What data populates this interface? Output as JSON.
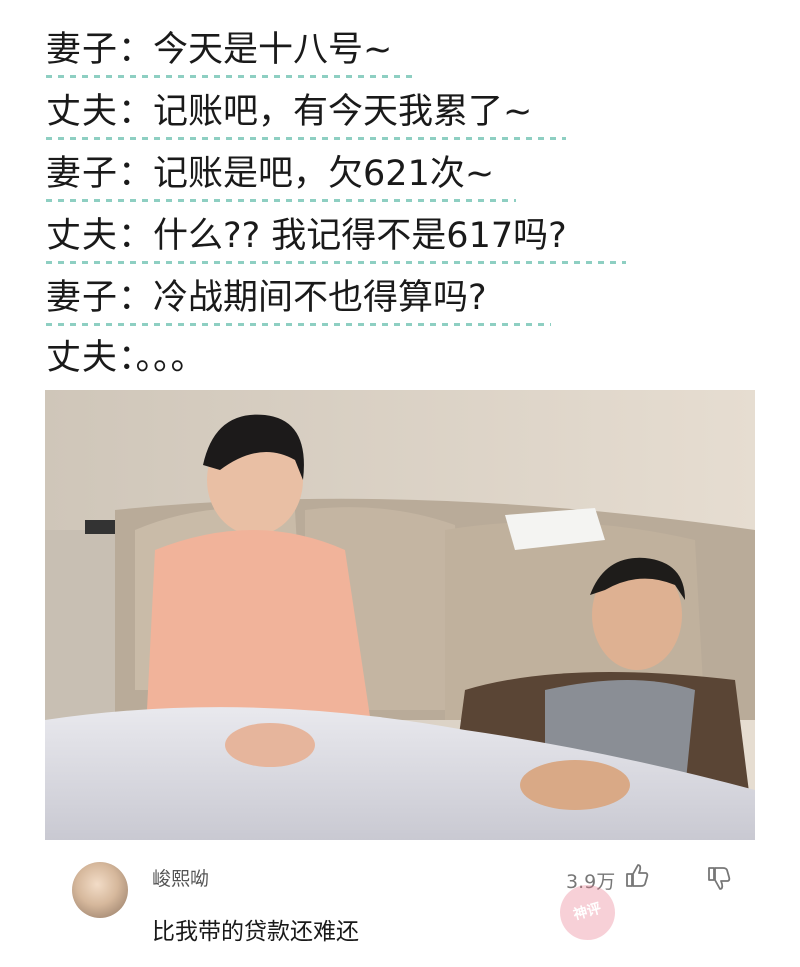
{
  "dialogue": [
    {
      "speaker": "妻子",
      "text": "今天是十八号~"
    },
    {
      "speaker": "丈夫",
      "text": "记账吧，有今天我累了~"
    },
    {
      "speaker": "妻子",
      "text": "记账是吧，欠621次~"
    },
    {
      "speaker": "丈夫",
      "text": "什么?? 我记得不是617吗?"
    },
    {
      "speaker": "妻子",
      "text": "冷战期间不也得算吗?"
    },
    {
      "speaker": "丈夫",
      "text": "。。。"
    }
  ],
  "separator": "：",
  "comment": {
    "username": "峻熙呦",
    "text": "比我带的贷款还难还",
    "likes": "3.9万",
    "stamp": "神评"
  },
  "colors": {
    "underline": "#8ecfc2",
    "text": "#1a1a1a",
    "muted": "#777777"
  },
  "icons": [
    "thumbs-up-icon",
    "thumbs-down-icon"
  ]
}
